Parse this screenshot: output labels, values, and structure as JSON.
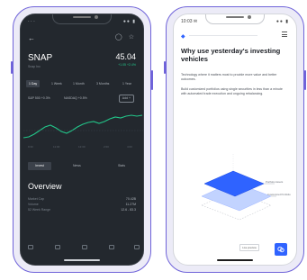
{
  "left_phone": {
    "status": {
      "time": "· · ·",
      "right": "●● ▮"
    },
    "back_label": "←",
    "icons": [
      "bell-icon",
      "star-icon"
    ],
    "ticker": "SNAP",
    "ticker_sub": "Snap Inc",
    "price": "45.04",
    "change": "+1.05   +2.4%",
    "ranges": [
      "1 Day",
      "1 Week",
      "1 Month",
      "3 Months",
      "1 Year"
    ],
    "active_range": 0,
    "compare_a": "S&P 500  +0.3%",
    "compare_b": "NASDAQ  +0.5%",
    "compare_button": "Add +",
    "chart_dates": [
      "9:30",
      "11:00",
      "12:30",
      "2:00",
      "4:00"
    ],
    "actions": [
      "Invest",
      "News",
      "Stats"
    ],
    "overview_title": "Overview",
    "overview_rows": [
      {
        "label": "Market Cap",
        "value": "70.42B"
      },
      {
        "label": "Volume",
        "value": "11.27M"
      },
      {
        "label": "52 Week Range",
        "value": "12.6 - 83.3"
      }
    ],
    "accent": "#23c589"
  },
  "right_phone": {
    "status": {
      "time": "10:03 ✉",
      "right": "●● ▮"
    },
    "logo": "◆",
    "headline": "Why use yesterday's investing vehicles",
    "paragraphs": [
      "Technology where it matters most to provide more value and better outcomes.",
      "Build customized portfolios using single securities in less than a minute with automated trade execution and ongoing rebalancing."
    ],
    "illustration_labels": [
      "Portfolio Assets",
      "Customized Portfolio"
    ],
    "chip_label": "Live preview",
    "fab_icon": "chat-icon",
    "brand_color": "#2f63ff"
  }
}
